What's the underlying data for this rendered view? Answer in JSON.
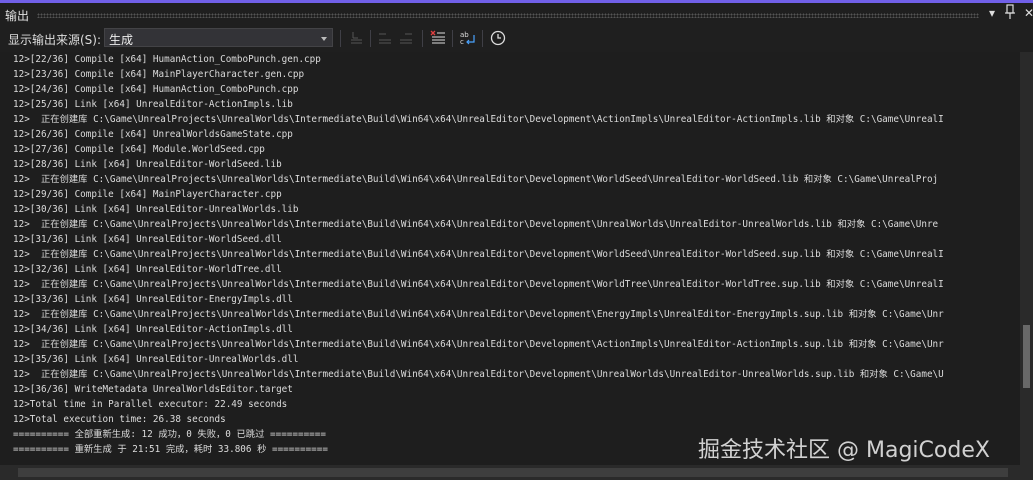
{
  "window": {
    "title": "输出",
    "accent": "#7160e8"
  },
  "titlebar_buttons": [
    {
      "name": "dropdown-icon",
      "glyph": "▾"
    },
    {
      "name": "pin-icon",
      "glyph": "⚲"
    },
    {
      "name": "close-icon",
      "glyph": "✕"
    }
  ],
  "toolbar": {
    "source_label": "显示输出来源(S):",
    "source_value": "生成"
  },
  "output_lines": [
    "12>[22/36] Compile [x64] HumanAction_ComboPunch.gen.cpp",
    "12>[23/36] Compile [x64] MainPlayerCharacter.gen.cpp",
    "12>[24/36] Compile [x64] HumanAction_ComboPunch.cpp",
    "12>[25/36] Link [x64] UnrealEditor-ActionImpls.lib",
    "12>  正在创建库 C:\\Game\\UnrealProjects\\UnrealWorlds\\Intermediate\\Build\\Win64\\x64\\UnrealEditor\\Development\\ActionImpls\\UnrealEditor-ActionImpls.lib 和对象 C:\\Game\\UnrealI",
    "12>[26/36] Compile [x64] UnrealWorldsGameState.cpp",
    "12>[27/36] Compile [x64] Module.WorldSeed.cpp",
    "12>[28/36] Link [x64] UnrealEditor-WorldSeed.lib",
    "12>  正在创建库 C:\\Game\\UnrealProjects\\UnrealWorlds\\Intermediate\\Build\\Win64\\x64\\UnrealEditor\\Development\\WorldSeed\\UnrealEditor-WorldSeed.lib 和对象 C:\\Game\\UnrealProj",
    "12>[29/36] Compile [x64] MainPlayerCharacter.cpp",
    "12>[30/36] Link [x64] UnrealEditor-UnrealWorlds.lib",
    "12>  正在创建库 C:\\Game\\UnrealProjects\\UnrealWorlds\\Intermediate\\Build\\Win64\\x64\\UnrealEditor\\Development\\UnrealWorlds\\UnrealEditor-UnrealWorlds.lib 和对象 C:\\Game\\Unre",
    "12>[31/36] Link [x64] UnrealEditor-WorldSeed.dll",
    "12>  正在创建库 C:\\Game\\UnrealProjects\\UnrealWorlds\\Intermediate\\Build\\Win64\\x64\\UnrealEditor\\Development\\WorldSeed\\UnrealEditor-WorldSeed.sup.lib 和对象 C:\\Game\\UnrealI",
    "12>[32/36] Link [x64] UnrealEditor-WorldTree.dll",
    "12>  正在创建库 C:\\Game\\UnrealProjects\\UnrealWorlds\\Intermediate\\Build\\Win64\\x64\\UnrealEditor\\Development\\WorldTree\\UnrealEditor-WorldTree.sup.lib 和对象 C:\\Game\\UnrealI",
    "12>[33/36] Link [x64] UnrealEditor-EnergyImpls.dll",
    "12>  正在创建库 C:\\Game\\UnrealProjects\\UnrealWorlds\\Intermediate\\Build\\Win64\\x64\\UnrealEditor\\Development\\EnergyImpls\\UnrealEditor-EnergyImpls.sup.lib 和对象 C:\\Game\\Unr",
    "12>[34/36] Link [x64] UnrealEditor-ActionImpls.dll",
    "12>  正在创建库 C:\\Game\\UnrealProjects\\UnrealWorlds\\Intermediate\\Build\\Win64\\x64\\UnrealEditor\\Development\\ActionImpls\\UnrealEditor-ActionImpls.sup.lib 和对象 C:\\Game\\Unr",
    "12>[35/36] Link [x64] UnrealEditor-UnrealWorlds.dll",
    "12>  正在创建库 C:\\Game\\UnrealProjects\\UnrealWorlds\\Intermediate\\Build\\Win64\\x64\\UnrealEditor\\Development\\UnrealWorlds\\UnrealEditor-UnrealWorlds.sup.lib 和对象 C:\\Game\\U",
    "12>[36/36] WriteMetadata UnrealWorldsEditor.target",
    "12>Total time in Parallel executor: 22.49 seconds",
    "12>Total execution time: 26.38 seconds",
    "========== 全部重新生成: 12 成功，0 失败，0 已跳过 ==========",
    "========== 重新生成 于 21:51 完成，耗时 33.806 秒 =========="
  ],
  "watermark": "掘金技术社区 @ MagiCodeX"
}
